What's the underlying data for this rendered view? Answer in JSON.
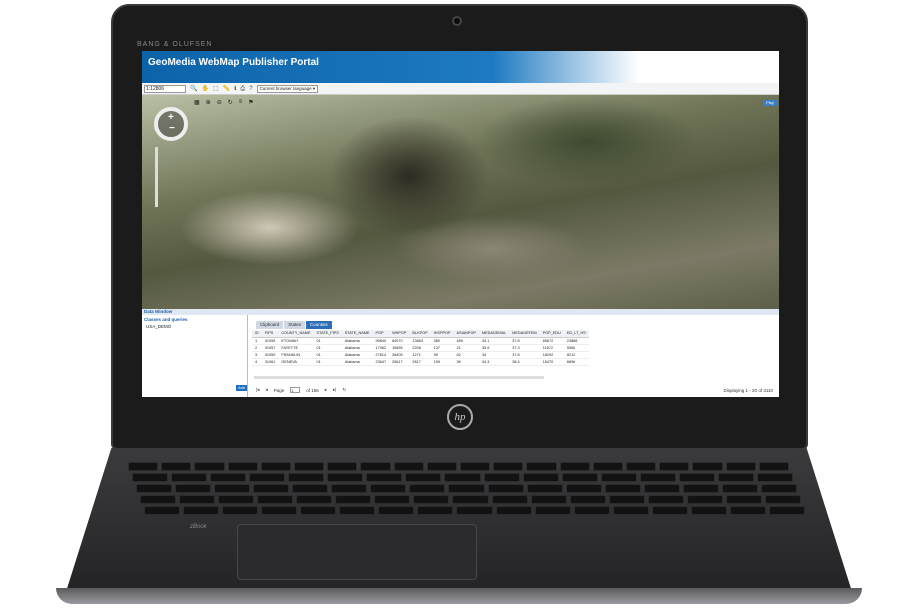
{
  "device": {
    "brand_text": "BANG & OLUFSEN",
    "logo_text": "hp",
    "book_text": "zBook"
  },
  "app": {
    "title": "GeoMedia WebMap Publisher Portal"
  },
  "toolbar": {
    "scale_value": "1:12806",
    "language_label": "Current browser language ▾",
    "icons": [
      "zoom-icon",
      "pan-icon",
      "select-icon",
      "measure-icon",
      "print-icon",
      "info-icon",
      "help-icon"
    ]
  },
  "map": {
    "play_label": "Play"
  },
  "data_window": {
    "title": "Data Window",
    "classes_title": "Classes and queries",
    "tree_item": "USA_DEMO",
    "add_label": "Add",
    "tabs": [
      {
        "label": "Clipboard",
        "active": false
      },
      {
        "label": "States",
        "active": false
      },
      {
        "label": "Counties",
        "active": true
      }
    ],
    "columns": [
      "ID",
      "FIPS",
      "COUNTY_NAME",
      "STATE_FIPS",
      "STATE_NAME",
      "POP",
      "WHPOP",
      "BLKPOP",
      "HISPPOP",
      "ASIANPOP",
      "MEDAGEMAL",
      "MEDAGEFEM",
      "POP_EDU",
      "ED_LT_HS"
    ],
    "rows": [
      [
        "1",
        "01055",
        "ETOWAH",
        "01",
        "Alabama",
        "99840",
        "84970",
        "13863",
        "380",
        "489",
        "34.1",
        "37.8",
        "65672",
        "23888"
      ],
      [
        "2",
        "01057",
        "FAYETTE",
        "01",
        "Alabama",
        "17962",
        "15655",
        "2206",
        "137",
        "21",
        "33.9",
        "37.3",
        "11672",
        "5060"
      ],
      [
        "3",
        "01059",
        "FRANKLIN",
        "01",
        "Alabama",
        "27814",
        "26405",
        "1271",
        "95",
        "62",
        "34",
        "37.8",
        "18292",
        "8212"
      ],
      [
        "4",
        "01061",
        "GENEVA",
        "01",
        "Alabama",
        "23647",
        "20617",
        "2817",
        "159",
        "36",
        "34.3",
        "38.4",
        "15470",
        "6896"
      ]
    ],
    "pager": {
      "page_label": "Page",
      "page_value": "1",
      "of_label": "of 156",
      "displaying": "Displaying 1 - 20 of 3110"
    }
  }
}
